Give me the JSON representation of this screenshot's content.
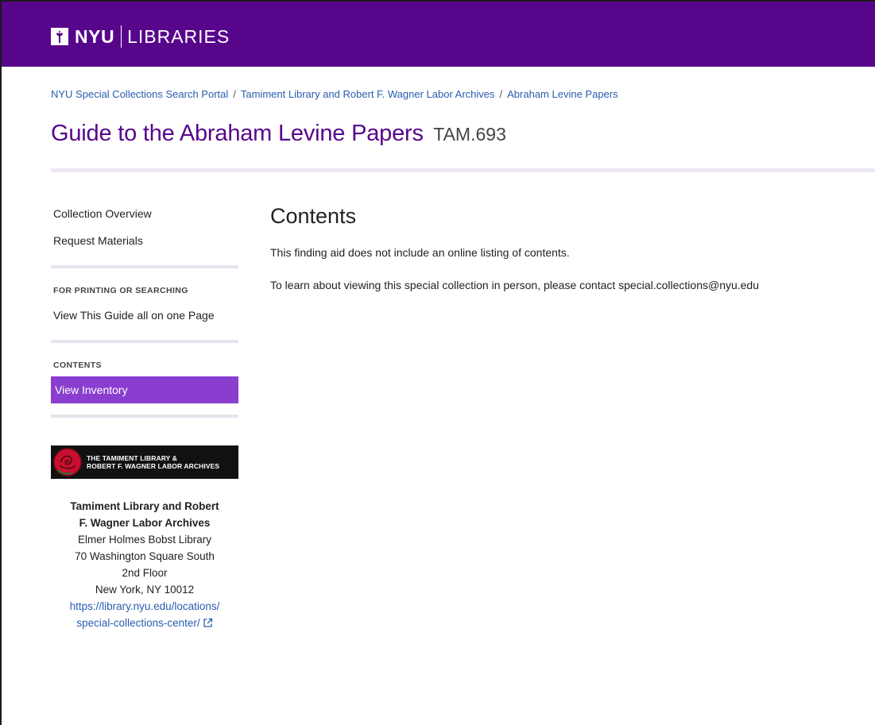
{
  "header": {
    "logo_nyu": "NYU",
    "logo_libraries": "LIBRARIES",
    "brand_color": "#57068c"
  },
  "breadcrumb": {
    "items": [
      {
        "label": "NYU Special Collections Search Portal"
      },
      {
        "label": "Tamiment Library and Robert F. Wagner Labor Archives"
      },
      {
        "label": "Abraham Levine Papers"
      }
    ],
    "separator": "/"
  },
  "title": {
    "text": "Guide to the Abraham Levine Papers",
    "call_number": "TAM.693"
  },
  "sidebar": {
    "links": [
      {
        "label": "Collection Overview"
      },
      {
        "label": "Request Materials"
      }
    ],
    "printing_section": {
      "heading": "FOR PRINTING OR SEARCHING",
      "link": "View This Guide all on one Page"
    },
    "contents_section": {
      "heading": "CONTENTS",
      "active_link": "View Inventory",
      "active_color": "#8a3ecf"
    }
  },
  "repository": {
    "banner_line1": "THE TAMIMENT LIBRARY &",
    "banner_line2": "ROBERT F. WAGNER LABOR ARCHIVES",
    "name_line1": "Tamiment Library and Robert",
    "name_line2": "F. Wagner Labor Archives",
    "building": "Elmer Holmes Bobst Library",
    "street": "70 Washington Square South",
    "floor": "2nd Floor",
    "city": "New York, NY 10012",
    "url_line1": "https://library.nyu.edu/locations/",
    "url_line2": "special-collections-center/",
    "link_icon": "external-link-icon"
  },
  "main": {
    "heading": "Contents",
    "paragraph1": "This finding aid does not include an online listing of contents.",
    "paragraph2": "To learn about viewing this special collection in person, please contact special.collections@nyu.edu"
  }
}
